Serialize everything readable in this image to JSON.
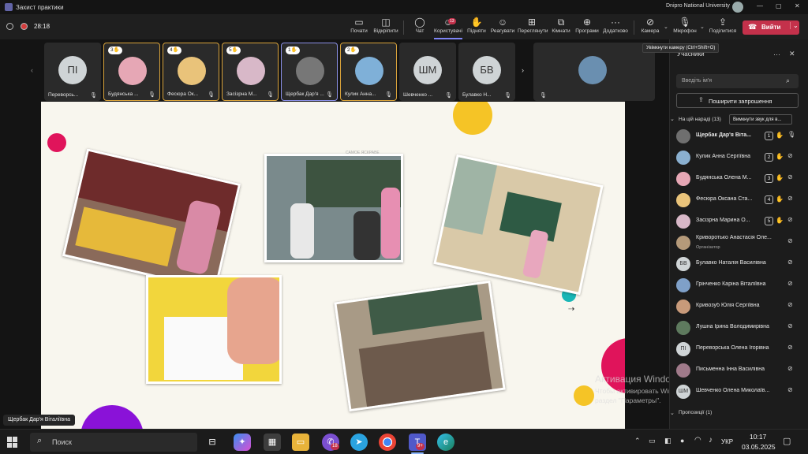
{
  "window": {
    "title": "Захист практики",
    "org": "Dnipro National University",
    "controls": [
      "—",
      "▢",
      "✕"
    ]
  },
  "meeting": {
    "timer": "28:18"
  },
  "toolbar": {
    "items": [
      {
        "label": "Почати",
        "icon": "share-screen-icon"
      },
      {
        "label": "Відкріпити",
        "icon": "unpin-icon"
      },
      {
        "label": "Чат",
        "icon": "chat-icon"
      },
      {
        "label": "Користувачі",
        "icon": "people-icon",
        "badge": "13"
      },
      {
        "label": "Підняти",
        "icon": "raise-hand-icon"
      },
      {
        "label": "Реагувати",
        "icon": "react-icon"
      },
      {
        "label": "Переглянути",
        "icon": "view-icon"
      },
      {
        "label": "Кімнати",
        "icon": "rooms-icon"
      },
      {
        "label": "Програми",
        "icon": "apps-icon"
      },
      {
        "label": "Додатково",
        "icon": "more-icon"
      },
      {
        "label": "Камера",
        "icon": "camera-icon"
      },
      {
        "label": "Мікрофон",
        "icon": "microphone-icon"
      },
      {
        "label": "Поділитися",
        "icon": "share-icon"
      }
    ],
    "leave_label": "Вийти",
    "camera_tooltip": "Увімкнути камеру (Ctrl+Shift+O)"
  },
  "strip": {
    "tiles": [
      {
        "name": "Переворсь...",
        "initials": "ПІ",
        "hand": ""
      },
      {
        "name": "Будянська ...",
        "initials": "",
        "hand": "3"
      },
      {
        "name": "Фесюра Ок...",
        "initials": "",
        "hand": "4"
      },
      {
        "name": "Засізрна М...",
        "initials": "",
        "hand": "5"
      },
      {
        "name": "Щербак Дар'я ...",
        "initials": "",
        "hand": "1"
      },
      {
        "name": "Кулик Анна...",
        "initials": "",
        "hand": "2"
      },
      {
        "name": "Шевченко ...",
        "initials": "ШМ",
        "hand": ""
      },
      {
        "name": "Булавко Н...",
        "initials": "БВ",
        "hand": ""
      }
    ]
  },
  "stage": {
    "presenter_label": "Щербак Дар'я Віталіївна"
  },
  "slide": {
    "photo_caption": "САМОЕ ЯСКРАВЕ"
  },
  "panel": {
    "title": "Учасники",
    "search_placeholder": "Введіть ім'я",
    "invite_label": "Поширити запрошення",
    "in_meeting_label": "На цій нараді (13)",
    "mute_all_label": "Вимкнути звук для в...",
    "proposed_label": "Пропозиції (1)",
    "participants": [
      {
        "name": "Щербак Дар'я Віта...",
        "initials": "",
        "rank": "1",
        "hand": true,
        "mic": "on",
        "sub": ""
      },
      {
        "name": "Кулик Анна Сергіївна",
        "initials": "",
        "rank": "2",
        "hand": true,
        "mic": "off",
        "sub": ""
      },
      {
        "name": "Будянська Олена М...",
        "initials": "",
        "rank": "3",
        "hand": true,
        "mic": "off",
        "sub": ""
      },
      {
        "name": "Фесюра Оксана Ста...",
        "initials": "",
        "rank": "4",
        "hand": true,
        "mic": "off",
        "sub": ""
      },
      {
        "name": "Засізрна Марина О...",
        "initials": "",
        "rank": "5",
        "hand": true,
        "mic": "off",
        "sub": ""
      },
      {
        "name": "Криворотько Анастасія Оле...",
        "initials": "",
        "rank": "",
        "hand": false,
        "mic": "off",
        "sub": "Організатор"
      },
      {
        "name": "Булавко Наталія Василівна",
        "initials": "БВ",
        "rank": "",
        "hand": false,
        "mic": "off",
        "sub": ""
      },
      {
        "name": "Грінченко Каріна Віталіївна",
        "initials": "",
        "rank": "",
        "hand": false,
        "mic": "off",
        "sub": ""
      },
      {
        "name": "Кривозуб Юлія Сергіївна",
        "initials": "",
        "rank": "",
        "hand": false,
        "mic": "off",
        "sub": ""
      },
      {
        "name": "Лушна Ірина Володимирівна",
        "initials": "",
        "rank": "",
        "hand": false,
        "mic": "off",
        "sub": ""
      },
      {
        "name": "Переворська Олена Ігорівна",
        "initials": "ПІ",
        "rank": "",
        "hand": false,
        "mic": "off",
        "sub": ""
      },
      {
        "name": "Письменна Інна Василівна",
        "initials": "",
        "rank": "",
        "hand": false,
        "mic": "off",
        "sub": ""
      },
      {
        "name": "Шевченко Олена Миколаїв...",
        "initials": "ШМ",
        "rank": "",
        "hand": false,
        "mic": "off",
        "sub": ""
      }
    ]
  },
  "activation": {
    "title": "Активация Windows",
    "line1": "Чтобы активировать Windows, перейдите в",
    "line2": "раздел \"Параметры\"."
  },
  "taskbar": {
    "search_placeholder": "Поиск",
    "teams_badge": "18",
    "teams2_badge": "9+",
    "lang": "УКР",
    "time": "10:17",
    "date": "03.05.2025"
  }
}
